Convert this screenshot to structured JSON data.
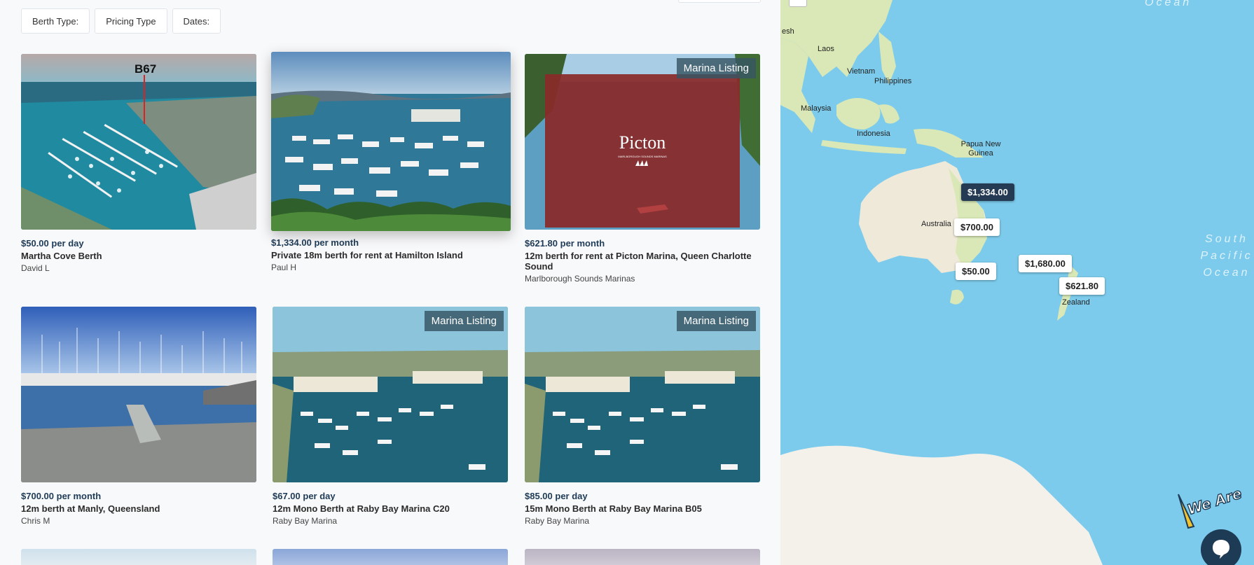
{
  "filters": {
    "berth_type": "Berth Type:",
    "pricing_type": "Pricing Type",
    "dates": "Dates:"
  },
  "listings": [
    {
      "price": "$50.00",
      "unit": "per day",
      "title": "Martha Cove Berth",
      "owner": "David L",
      "photo_text": "B67"
    },
    {
      "price": "$1,334.00",
      "unit": "per month",
      "title": "Private 18m berth for rent at Hamilton Island",
      "owner": "Paul H"
    },
    {
      "price": "$621.80",
      "unit": "per month",
      "title": "12m berth for rent at Picton Marina, Queen Charlotte Sound",
      "owner": "Marlborough Sounds Marinas",
      "badge": "Marina Listing",
      "logo_text": "Picton",
      "logo_sub": "MARLBOROUGH SOUNDS MARINAS"
    },
    {
      "price": "$700.00",
      "unit": "per month",
      "title": "12m berth at Manly, Queensland",
      "owner": "Chris M"
    },
    {
      "price": "$67.00",
      "unit": "per day",
      "title": "12m Mono Berth at Raby Bay Marina C20",
      "owner": "Raby Bay Marina",
      "badge": "Marina Listing"
    },
    {
      "price": "$85.00",
      "unit": "per day",
      "title": "15m Mono Berth at Raby Bay Marina B05",
      "owner": "Raby Bay Marina",
      "badge": "Marina Listing"
    }
  ],
  "map": {
    "labels": {
      "laos": "Laos",
      "vietnam": "Vietnam",
      "philippines": "Philippines",
      "malaysia": "Malaysia",
      "indonesia": "Indonesia",
      "png": "Papua New Guinea",
      "australia": "Australia",
      "zealand": "Zealand",
      "esh": "esh",
      "ocean_top": "Ocean",
      "south_pacific": "South Pacific Ocean"
    },
    "pins": {
      "p1334": "$1,334.00",
      "p700": "$700.00",
      "p1680": "$1,680.00",
      "p50": "$50.00",
      "p621": "$621.80"
    }
  },
  "chat": {
    "we_are_here": "We Are Here!"
  },
  "colors": {
    "ocean": "#7ccbec",
    "land": "#efe9d9",
    "vegetation": "#d9e8b6",
    "price_text": "#1f3b57",
    "active_pin": "#243b53"
  }
}
